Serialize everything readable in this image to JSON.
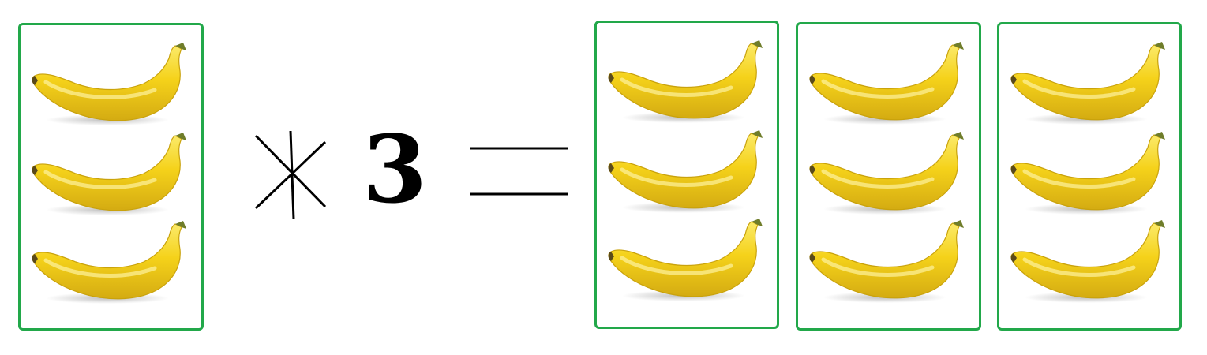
{
  "equation": {
    "multiplier": "3",
    "operator_icon": "multiply-icon",
    "equals_icon": "equals-icon"
  },
  "colors": {
    "box_border": "#22a84a",
    "banana_body": "#f5d21a",
    "banana_highlight": "#fbea6a",
    "banana_shade": "#c9a20c",
    "banana_stem": "#6f7d2a"
  },
  "groups": {
    "left": {
      "banana_count": 3
    },
    "right": [
      {
        "banana_count": 3
      },
      {
        "banana_count": 3
      },
      {
        "banana_count": 3
      }
    ]
  }
}
